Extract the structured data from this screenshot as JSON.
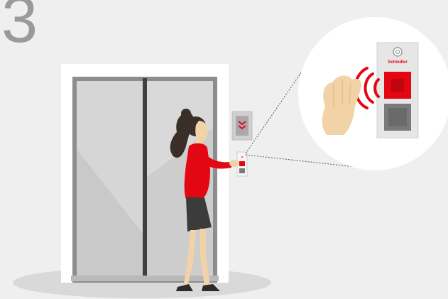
{
  "step": {
    "number": "3"
  },
  "panel": {
    "brand": "Schindler"
  },
  "colors": {
    "background": "#efefef",
    "floor_shadow": "#d9d9d9",
    "door_frame": "#ffffff",
    "door_panel": "#c7c7c7",
    "accent_red": "#e30613",
    "skin": "#f2d3a7",
    "skirt": "#3b3b3b",
    "hair": "#3a2e29",
    "panel_gray": "#6f6f6f"
  },
  "icons": [
    "hand-icon",
    "wireless-signal-icon",
    "schindler-logo-icon",
    "call-button-icon",
    "down-arrow-icon"
  ]
}
